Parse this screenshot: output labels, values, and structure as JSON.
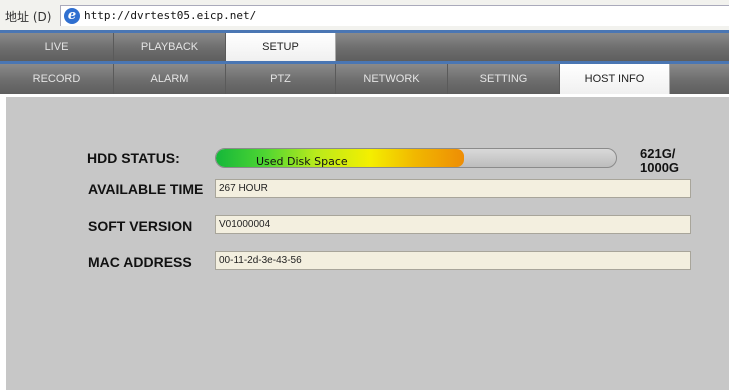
{
  "browser": {
    "address_label": "地址 (D)",
    "url": "http://dvrtest05.eicp.net/"
  },
  "main_tabs": [
    {
      "label": "LIVE",
      "active": false
    },
    {
      "label": "PLAYBACK",
      "active": false
    },
    {
      "label": "SETUP",
      "active": true
    }
  ],
  "sub_tabs": [
    {
      "label": "RECORD",
      "active": false
    },
    {
      "label": "ALARM",
      "active": false
    },
    {
      "label": "PTZ",
      "active": false
    },
    {
      "label": "NETWORK",
      "active": false
    },
    {
      "label": "SETTING",
      "active": false
    },
    {
      "label": "HOST INFO",
      "active": true
    }
  ],
  "host_info": {
    "hdd_status_label": "HDD STATUS:",
    "disk_bar_text": "Used Disk Space",
    "used_fraction": 0.621,
    "capacity_used": "621G/",
    "capacity_total": "1000G",
    "available_time_label": "AVAILABLE TIME",
    "available_time_value": "267 HOUR",
    "soft_version_label": "SOFT VERSION",
    "soft_version_value": "V01000004",
    "mac_address_label": "MAC ADDRESS",
    "mac_address_value": "00-11-2d-3e-43-56"
  },
  "colors": {
    "tab_bar": "#6d6d6d",
    "content_bg": "#c7c7c7",
    "field_bg": "#f3efdf",
    "accent_line": "#4a76b3"
  }
}
